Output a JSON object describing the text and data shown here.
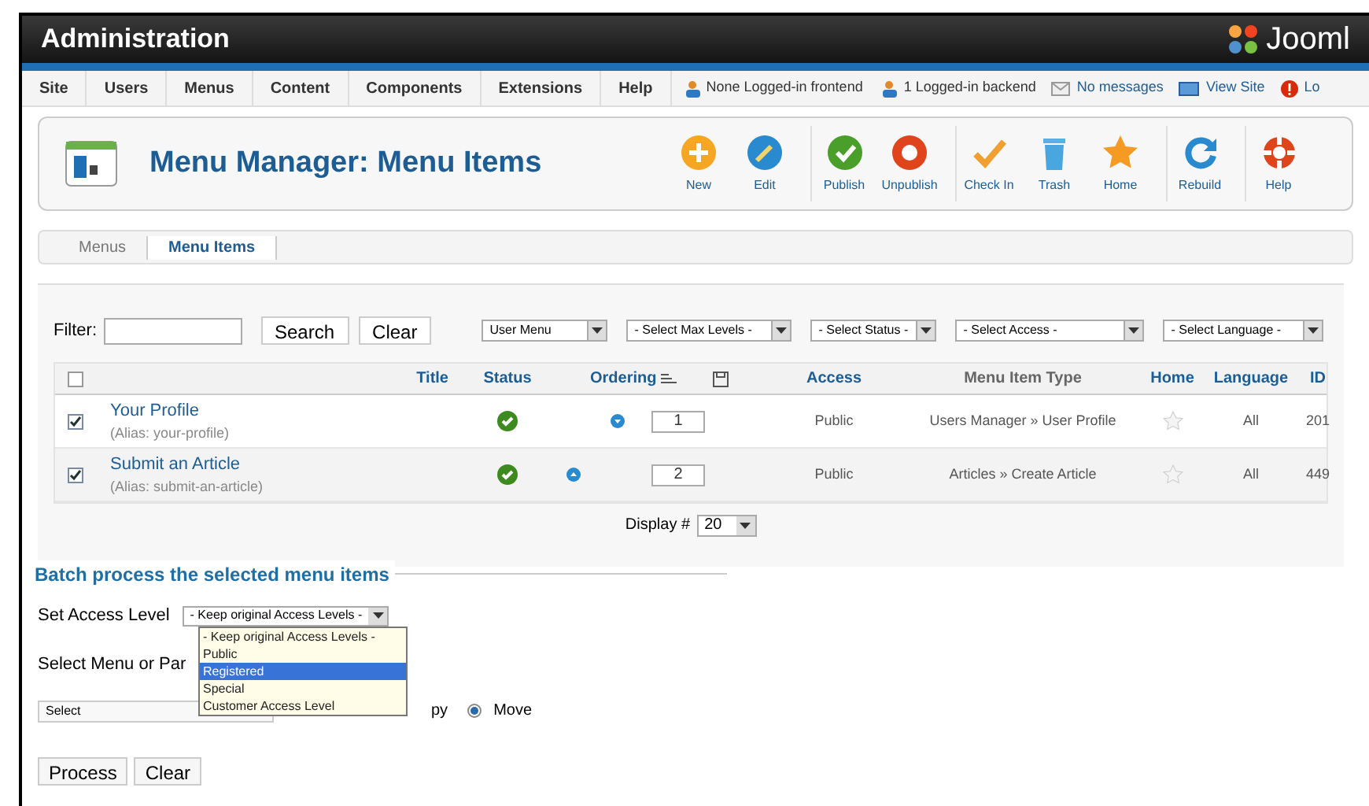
{
  "header": {
    "title": "Administration",
    "logo": "Jooml"
  },
  "menu": [
    "Site",
    "Users",
    "Menus",
    "Content",
    "Components",
    "Extensions",
    "Help"
  ],
  "status": [
    {
      "kind": "users",
      "text": "None Logged-in frontend"
    },
    {
      "kind": "users",
      "text": "1 Logged-in backend"
    },
    {
      "kind": "mail",
      "text": "No messages"
    },
    {
      "kind": "site",
      "text": "View Site"
    },
    {
      "kind": "logout",
      "text": "Lo"
    }
  ],
  "toolbar": {
    "title": "Menu Manager: Menu Items",
    "buttons": [
      {
        "kind": "new",
        "label": "New"
      },
      {
        "kind": "edit",
        "label": "Edit"
      },
      {
        "kind": "publish",
        "label": "Publish"
      },
      {
        "kind": "unpublish",
        "label": "Unpublish"
      },
      {
        "kind": "checkin",
        "label": "Check In"
      },
      {
        "kind": "trash",
        "label": "Trash"
      },
      {
        "kind": "home",
        "label": "Home"
      },
      {
        "kind": "rebuild",
        "label": "Rebuild"
      },
      {
        "kind": "help",
        "label": "Help"
      }
    ]
  },
  "subtabs": [
    {
      "label": "Menus",
      "selected": false
    },
    {
      "label": "Menu Items",
      "selected": true
    }
  ],
  "filter": {
    "label": "Filter:",
    "search": "Search",
    "clear": "Clear",
    "selects": [
      "User Menu",
      "- Select Max Levels -",
      "- Select Status -",
      "- Select Access -",
      "- Select Language -"
    ]
  },
  "table": {
    "select_all_checked": false,
    "columns": [
      "Title",
      "Status",
      "Ordering",
      "Access",
      "Menu Item Type",
      "Home",
      "Language",
      "ID"
    ],
    "rows": [
      {
        "checked": true,
        "title": "Your Profile",
        "alias": "(Alias: your-profile)",
        "published": true,
        "move_up": false,
        "move_down": true,
        "order": "1",
        "access": "Public",
        "type": "Users Manager » User Profile",
        "home": false,
        "language": "All",
        "id": "201"
      },
      {
        "checked": true,
        "title": "Submit an Article",
        "alias": "(Alias: submit-an-article)",
        "published": true,
        "move_up": true,
        "move_down": false,
        "order": "2",
        "access": "Public",
        "type": "Articles » Create Article",
        "home": false,
        "language": "All",
        "id": "449"
      }
    ]
  },
  "display": {
    "label": "Display #",
    "value": "20"
  },
  "batch": {
    "legend": "Batch process the selected menu items",
    "access_label": "Set Access Level",
    "access_value": "- Keep original Access Levels -",
    "access_options": [
      {
        "label": "- Keep original Access Levels -",
        "selected": false
      },
      {
        "label": "Public",
        "selected": false
      },
      {
        "label": "Registered",
        "selected": true
      },
      {
        "label": "Special",
        "selected": false
      },
      {
        "label": "Customer Access Level",
        "selected": false
      }
    ],
    "menu_label": "Select Menu or Par",
    "menu_value": "Select",
    "copy_label": "py",
    "move": {
      "label": "Move",
      "selected": true
    },
    "process": "Process",
    "clear": "Clear"
  }
}
